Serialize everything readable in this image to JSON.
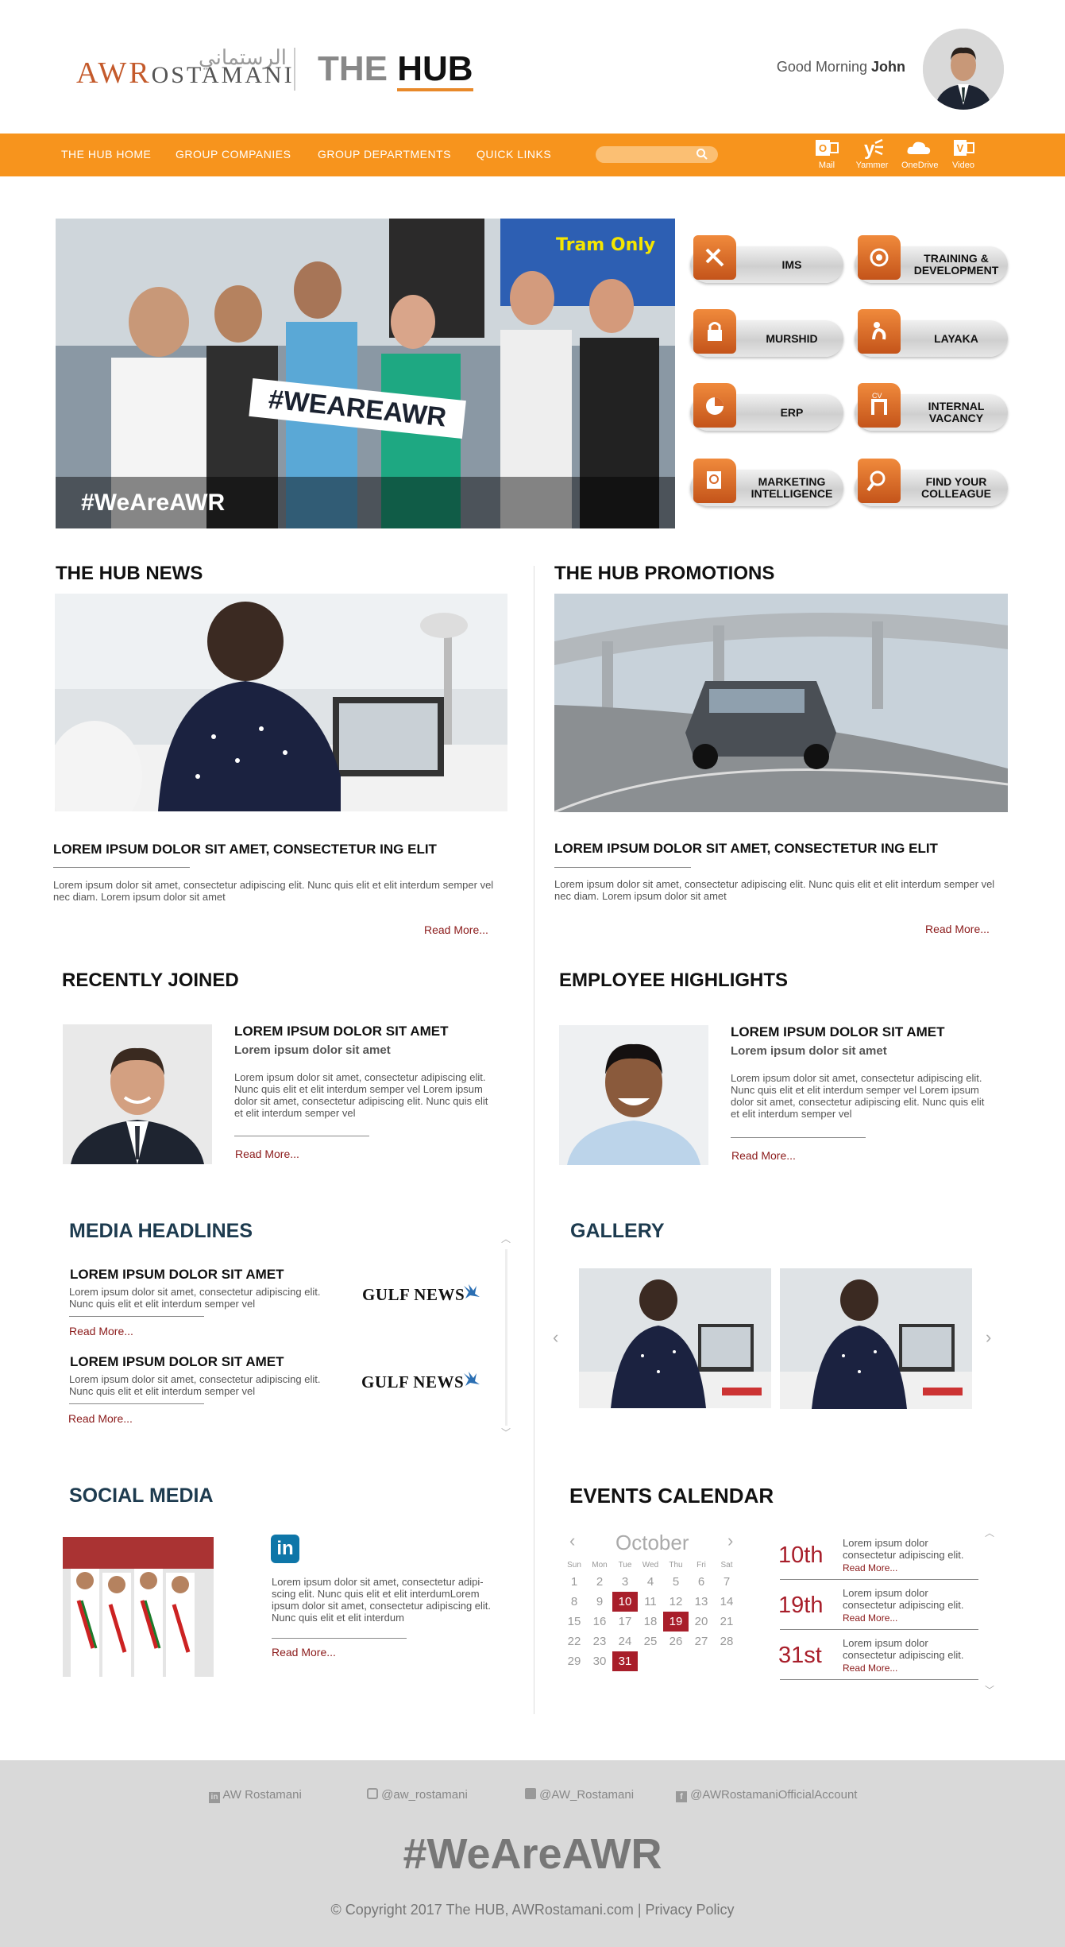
{
  "header": {
    "logo_arabic": "الرستماني",
    "logo_text_a": "AWR",
    "logo_text_b": "OSTAMANI",
    "title_a": "THE",
    "title_b": "HUB",
    "greeting": "Good Morning",
    "user_name": "John"
  },
  "nav": {
    "items": [
      "THE HUB HOME",
      "GROUP COMPANIES",
      "GROUP DEPARTMENTS",
      "QUICK LINKS"
    ],
    "search_placeholder": "",
    "apps": [
      {
        "label": "Mail",
        "icon": "outlook-icon"
      },
      {
        "label": "Yammer",
        "icon": "yammer-icon"
      },
      {
        "label": "OneDrive",
        "icon": "onedrive-icon"
      },
      {
        "label": "Video",
        "icon": "video-icon"
      }
    ]
  },
  "hero": {
    "caption": "#WeAreAWR",
    "sign_text": "#WEAREAWR"
  },
  "quicklinks": [
    {
      "label": "IMS",
      "icon": "tools-icon"
    },
    {
      "label": "TRAINING & DEVELOPMENT",
      "icon": "target-icon"
    },
    {
      "label": "MURSHID",
      "icon": "lock-icon"
    },
    {
      "label": "LAYAKA",
      "icon": "fitness-icon"
    },
    {
      "label": "ERP",
      "icon": "pie-chart-icon"
    },
    {
      "label": "INTERNAL VACANCY",
      "icon": "cv-icon"
    },
    {
      "label": "MARKETING INTELLIGENCE",
      "icon": "search-document-icon"
    },
    {
      "label": "FIND YOUR COLLEAGUE",
      "icon": "magnifier-icon"
    }
  ],
  "news": {
    "heading": "THE HUB NEWS",
    "title": "LOREM IPSUM DOLOR SIT AMET, CONSECTETUR ING ELIT",
    "body": "Lorem ipsum dolor sit amet, consectetur adipiscing elit. Nunc quis elit et elit interdum semper vel nec diam. Lorem ipsum dolor sit amet",
    "read_more": "Read More..."
  },
  "promotions": {
    "heading": "THE HUB PROMOTIONS",
    "title": "LOREM IPSUM DOLOR SIT AMET, CONSECTETUR ING ELIT",
    "body": "Lorem ipsum dolor sit amet, consectetur adipiscing elit. Nunc quis elit et elit interdum semper vel nec diam. Lorem ipsum dolor sit amet",
    "read_more": "Read More..."
  },
  "recently_joined": {
    "heading": "RECENTLY JOINED",
    "title": "LOREM IPSUM DOLOR SIT AMET",
    "subtitle": "Lorem ipsum dolor sit amet",
    "body": "Lorem ipsum dolor sit amet, consectetur adipiscing elit. Nunc quis elit et elit interdum semper vel Lorem ipsum dolor sit amet, consectetur adipiscing elit. Nunc quis elit et elit interdum semper vel",
    "read_more": "Read More..."
  },
  "employee_highlights": {
    "heading": "EMPLOYEE HIGHLIGHTS",
    "title": "LOREM IPSUM DOLOR SIT AMET",
    "subtitle": "Lorem ipsum dolor sit amet",
    "body": "Lorem ipsum dolor sit amet, consectetur adipiscing elit. Nunc quis elit et elit interdum semper vel Lorem ipsum dolor sit amet, consectetur adipiscing elit. Nunc quis elit et elit interdum semper vel",
    "read_more": "Read More..."
  },
  "media": {
    "heading": "MEDIA HEADLINES",
    "items": [
      {
        "title": "LOREM IPSUM DOLOR SIT AMET",
        "body": "Lorem ipsum dolor sit amet, consectetur adipiscing elit. Nunc quis elit et elit interdum semper vel",
        "read_more": "Read More...",
        "source": "GULF NEWS"
      },
      {
        "title": "LOREM IPSUM DOLOR SIT AMET",
        "body": "Lorem ipsum dolor sit amet, consectetur adipiscing elit. Nunc quis elit et elit interdum semper vel",
        "read_more": "Read More...",
        "source": "GULF NEWS"
      }
    ]
  },
  "gallery": {
    "heading": "GALLERY"
  },
  "social": {
    "heading": "SOCIAL MEDIA",
    "network": "in",
    "body": "Lorem ipsum dolor sit amet, consectetur adipi-scing elit. Nunc quis elit et elit interdumLorem ipsum dolor sit amet, consectetur adipiscing elit. Nunc quis elit et elit interdum",
    "read_more": "Read More..."
  },
  "calendar": {
    "heading": "EVENTS CALENDAR",
    "month": "October",
    "weekdays": [
      "Sun",
      "Mon",
      "Tue",
      "Wed",
      "Thu",
      "Fri",
      "Sat"
    ],
    "weeks": [
      [
        "1",
        "2",
        "3",
        "4",
        "5",
        "6",
        "7"
      ],
      [
        "8",
        "9",
        "10",
        "11",
        "12",
        "13",
        "14"
      ],
      [
        "15",
        "16",
        "17",
        "18",
        "19",
        "20",
        "21"
      ],
      [
        "22",
        "23",
        "24",
        "25",
        "26",
        "27",
        "28"
      ],
      [
        "29",
        "30",
        "31",
        "",
        "",
        "",
        ""
      ]
    ],
    "highlighted": [
      "10",
      "19",
      "31"
    ],
    "highlight_color": "#a81e2a",
    "events": [
      {
        "date": "10th",
        "text": "Lorem ipsum dolor consectetur adipiscing elit.",
        "read_more": "Read More..."
      },
      {
        "date": "19th",
        "text": "Lorem ipsum dolor consectetur adipiscing elit.",
        "read_more": "Read More..."
      },
      {
        "date": "31st",
        "text": "Lorem ipsum dolor consectetur adipiscing elit.",
        "read_more": "Read More..."
      }
    ]
  },
  "footer": {
    "socials": [
      {
        "label": "AW Rostamani",
        "icon": "linkedin-icon"
      },
      {
        "label": "@aw_rostamani",
        "icon": "instagram-icon"
      },
      {
        "label": "@AW_Rostamani",
        "icon": "twitter-icon"
      },
      {
        "label": "@AWRostamaniOfficialAccount",
        "icon": "facebook-icon"
      }
    ],
    "hashtag": "#WeAreAWR",
    "copyright": "© Copyright 2017  The HUB,  AWRostamani.com | Privacy Policy"
  },
  "colors": {
    "accent": "#f7941d",
    "brand_red": "#a81e2a",
    "footer_bg": "#d9d9d9"
  }
}
